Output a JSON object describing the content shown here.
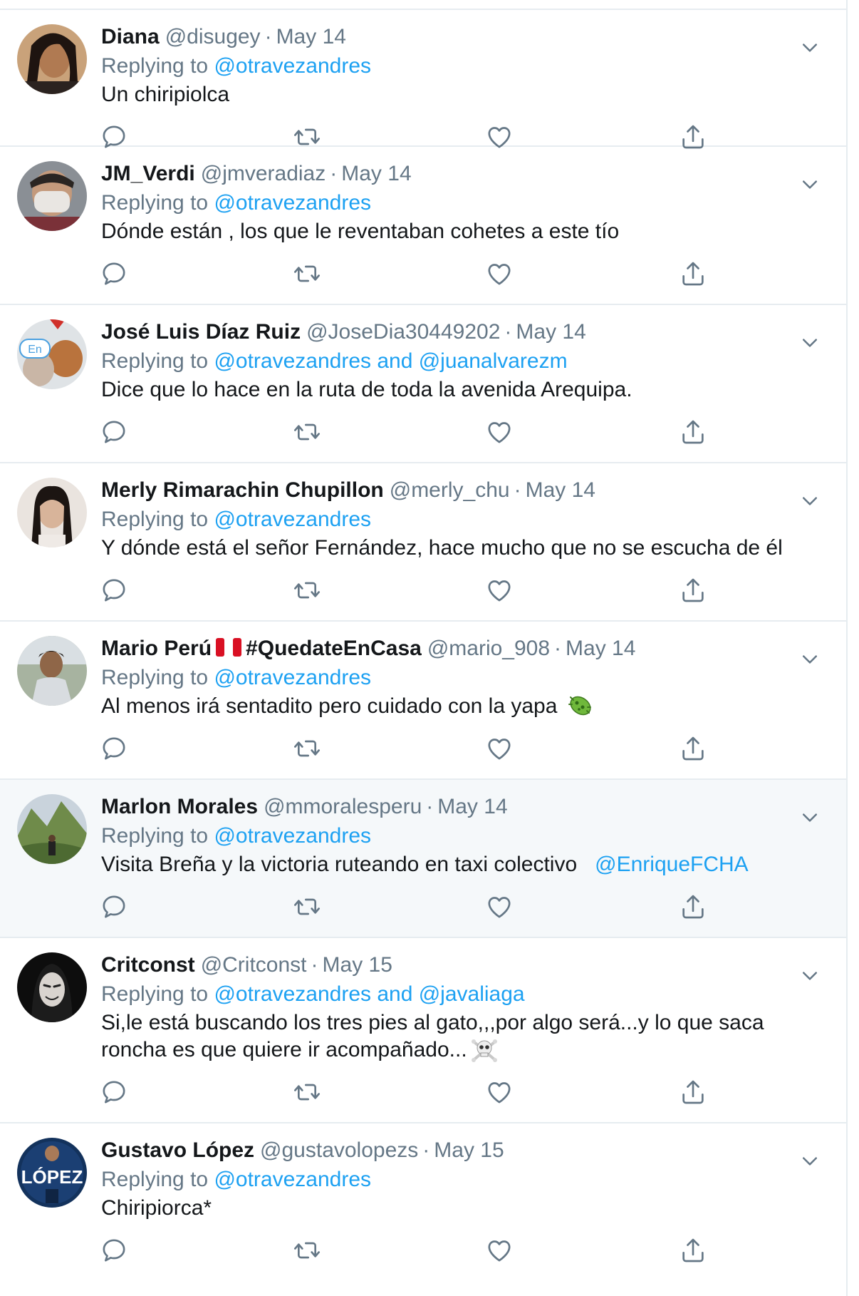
{
  "replying_to_label": "Replying to",
  "tweets": [
    {
      "name": "Diana",
      "handle": "@disugey",
      "sep": "·",
      "date": "May 14",
      "replying": "@otravezandres",
      "text": "Un chiripiolca"
    },
    {
      "name": "JM_Verdi",
      "handle": "@jmveradiaz",
      "sep": "·",
      "date": "May 14",
      "replying": "@otravezandres",
      "text": "Dónde están , los que le reventaban cohetes a este tío"
    },
    {
      "name": "José Luis Díaz Ruiz",
      "handle": "@JoseDia30449202",
      "sep": "·",
      "date": "May 14",
      "replying": "@otravezandres and @juanalvarezm",
      "text": "Dice que lo hace en la ruta de toda la avenida Arequipa.",
      "avatar_badge": "En"
    },
    {
      "name": "Merly Rimarachin Chupillon",
      "handle": "@merly_chu",
      "sep": "·",
      "date": "May 14",
      "replying": "@otravezandres",
      "text": "Y dónde está el señor Fernández, hace mucho que no se escucha de él"
    },
    {
      "name_part1": "Mario Perú",
      "name_part2": "#QuedateEnCasa",
      "handle": "@mario_908",
      "sep": "·",
      "date": "May 14",
      "replying": "@otravezandres",
      "text": "Al menos irá sentadito pero cuidado con la yapa",
      "emoji": "microbe"
    },
    {
      "name": "Marlon Morales",
      "handle": "@mmoralesperu",
      "sep": "·",
      "date": "May 14",
      "replying": "@otravezandres",
      "text": "Visita Breña y la victoria ruteando en taxi colectivo",
      "mention": "@EnriqueFCHA",
      "highlighted": true
    },
    {
      "name": "Critconst",
      "handle": "@Critconst",
      "sep": "·",
      "date": "May 15",
      "replying": "@otravezandres and @javaliaga",
      "text_line1": "Si,le está buscando los tres pies al gato,,,por algo será...y lo que saca",
      "text_line2": "roncha es que quiere ir acompañado...",
      "emoji": "skull-and-crossbones"
    },
    {
      "name": "Gustavo López",
      "handle": "@gustavolopezs",
      "sep": "·",
      "date": "May 15",
      "replying": "@otravezandres",
      "text": "Chiripiorca*",
      "avatar_text": "LÓPEZ"
    }
  ],
  "icons": {
    "reply": "reply-icon",
    "retweet": "retweet-icon",
    "like": "like-icon",
    "share": "share-icon",
    "caret": "chevron-down-icon"
  },
  "colors": {
    "link": "#1da1f2",
    "muted": "#657786",
    "text": "#14171a",
    "border": "#e6ecf0",
    "highlight_bg": "#f5f8fa"
  }
}
